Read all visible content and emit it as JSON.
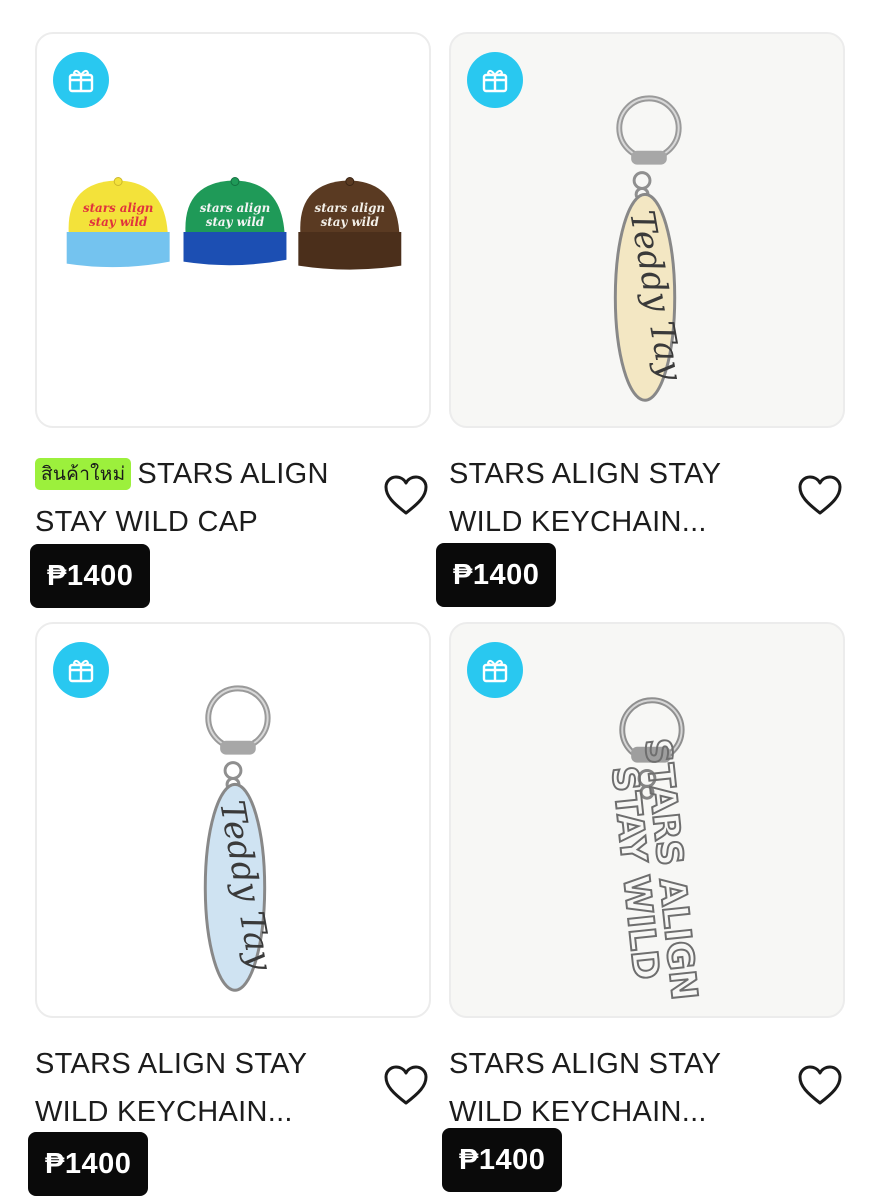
{
  "currency_symbol": "₱",
  "colors": {
    "gift_badge": "#29c8f0",
    "new_badge": "#9cf03c",
    "price_bg": "#0a0a0a"
  },
  "products": [
    {
      "badge": "สินค้าใหม่",
      "title": "STARS ALIGN STAY WILD CAP",
      "price": "₱1400",
      "gift_icon": "gift-icon",
      "wishlist_icon": "heart-outline-icon",
      "caps_text": "stars align stay wild"
    },
    {
      "badge": "",
      "title": "STARS ALIGN STAY WILD KEYCHAIN...",
      "price": "₱1400",
      "gift_icon": "gift-icon",
      "wishlist_icon": "heart-outline-icon",
      "tag_text": "Teddy Tay"
    },
    {
      "badge": "",
      "title": "STARS ALIGN STAY WILD KEYCHAIN...",
      "price": "₱1400",
      "gift_icon": "gift-icon",
      "wishlist_icon": "heart-outline-icon",
      "tag_text": "Teddy Tay"
    },
    {
      "badge": "",
      "title": "STARS ALIGN STAY WILD KEYCHAIN...",
      "price": "₱1400",
      "gift_icon": "gift-icon",
      "wishlist_icon": "heart-outline-icon",
      "tag_text": "STARS ALIGN STAY WILD"
    }
  ]
}
